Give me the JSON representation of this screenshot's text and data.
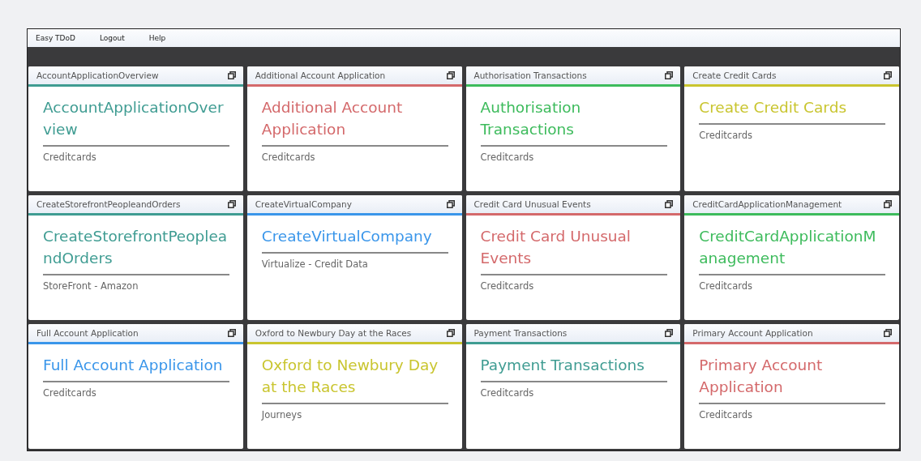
{
  "menu": [
    "Easy TDoD",
    "Logout",
    "Help"
  ],
  "tiles": [
    {
      "header": "AccountApplicationOverview",
      "title": "AccountApplicationOverview",
      "subtitle": "Creditcards",
      "color": "#3f9c92"
    },
    {
      "header": "Additional Account Application",
      "title": "Additional Account Application",
      "subtitle": "Creditcards",
      "color": "#d4696b"
    },
    {
      "header": "Authorisation Transactions",
      "title": "Authorisation Transactions",
      "subtitle": "Creditcards",
      "color": "#3dbb5c"
    },
    {
      "header": "Create Credit Cards",
      "title": "Create Credit Cards",
      "subtitle": "Creditcards",
      "color": "#c9c52f"
    },
    {
      "header": "CreateStorefrontPeopleandOrders",
      "title": "CreateStorefrontPeopleandOrders",
      "subtitle": "StoreFront - Amazon",
      "color": "#3f9c92"
    },
    {
      "header": "CreateVirtualCompany",
      "title": "CreateVirtualCompany",
      "subtitle": "Virtualize - Credit Data",
      "color": "#3a96ea"
    },
    {
      "header": "Credit Card Unusual Events",
      "title": "Credit Card Unusual Events",
      "subtitle": "Creditcards",
      "color": "#d4696b"
    },
    {
      "header": "CreditCardApplicationManagement",
      "title": "CreditCardApplicationManagement",
      "subtitle": "Creditcards",
      "color": "#3dbb5c"
    },
    {
      "header": "Full Account Application",
      "title": "Full Account Application",
      "subtitle": "Creditcards",
      "color": "#3a96ea"
    },
    {
      "header": "Oxford to Newbury Day at the Races",
      "title": "Oxford to Newbury Day at the Races",
      "subtitle": "Journeys",
      "color": "#c9c52f"
    },
    {
      "header": "Payment Transactions",
      "title": "Payment Transactions",
      "subtitle": "Creditcards",
      "color": "#3f9c92"
    },
    {
      "header": "Primary Account Application",
      "title": "Primary Account Application",
      "subtitle": "Creditcards",
      "color": "#d4696b"
    }
  ]
}
